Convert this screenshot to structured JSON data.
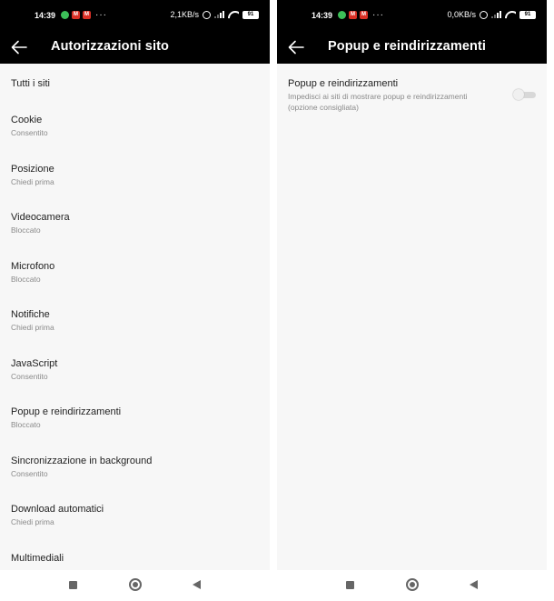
{
  "left": {
    "status": {
      "time": "14:39",
      "speed": "2,1KB/s",
      "battery": "91"
    },
    "title": "Autorizzazioni sito",
    "items": [
      {
        "label": "Tutti i siti",
        "sub": ""
      },
      {
        "label": "Cookie",
        "sub": "Consentito"
      },
      {
        "label": "Posizione",
        "sub": "Chiedi prima"
      },
      {
        "label": "Videocamera",
        "sub": "Bloccato"
      },
      {
        "label": "Microfono",
        "sub": "Bloccato"
      },
      {
        "label": "Notifiche",
        "sub": "Chiedi prima"
      },
      {
        "label": "JavaScript",
        "sub": "Consentito"
      },
      {
        "label": "Popup e reindirizzamenti",
        "sub": "Bloccato"
      },
      {
        "label": "Sincronizzazione in background",
        "sub": "Consentito"
      },
      {
        "label": "Download automatici",
        "sub": "Chiedi prima"
      },
      {
        "label": "Multimediali",
        "sub": ""
      }
    ]
  },
  "right": {
    "status": {
      "time": "14:39",
      "speed": "0,0KB/s",
      "battery": "91"
    },
    "title": "Popup e reindirizzamenti",
    "setting": {
      "label": "Popup e reindirizzamenti",
      "desc": "Impedisci ai siti di mostrare popup e reindirizzamenti (opzione consigliata)",
      "enabled": false
    }
  },
  "icons": {
    "notif1": "whatsapp-icon",
    "notif2": "gmail-icon",
    "notif3": "gmail-icon"
  }
}
